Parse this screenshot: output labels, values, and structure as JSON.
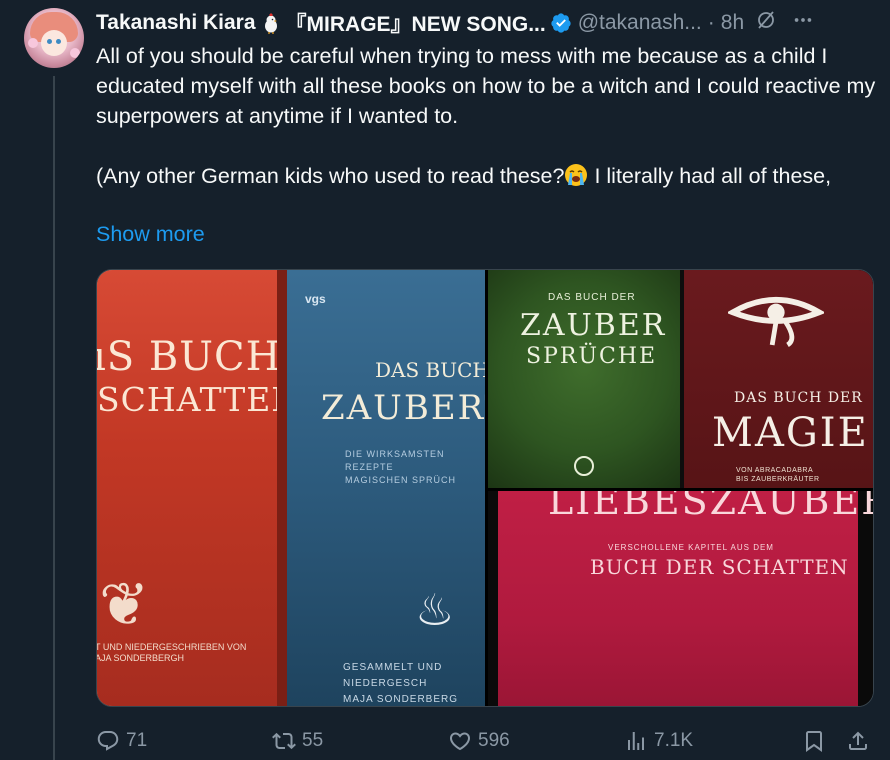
{
  "author": {
    "display_name": "Takanashi Kiara",
    "title_suffix": "『MIRAGE』NEW SONG...",
    "handle": "@takanash...",
    "time": "8h"
  },
  "tweet": {
    "paragraph1": "All of you should be careful when trying to mess with me because as a child I educated myself with all these books on how to be a witch and I could reactive my superpowers at anytime if I wanted to.",
    "paragraph2_a": "(Any other German kids who used to read these?",
    "paragraph2_b": " I literally had all of these,",
    "show_more": "Show more"
  },
  "media": {
    "book1": {
      "line1": "ıS BUCH",
      "line2": "SCHATTEN",
      "credit": "T UND NIEDERGESCHRIEBEN VON\nAJA SONDERBERGH"
    },
    "book2": {
      "publisher": "vgs",
      "line1": "DAS BUCH DER",
      "line2": "ZAUBERTRÄ",
      "subtitle": "DIE WIRKSAMSTEN REZEPTE\nMAGISCHEN SPRÜCH",
      "credit": "GESAMMELT UND NIEDERGESCH\nMAJA SONDERBERG"
    },
    "book3": {
      "small": "DAS BUCH DER",
      "line1": "ZAUBER",
      "line2": "SPRÜCHE"
    },
    "book4": {
      "small": "DAS BUCH DER",
      "title": "MAGIE",
      "subtitle": "VON ABRACADABRA\nBIS ZAUBERKRÄUTER"
    },
    "book5": {
      "title": "LIEBESZAUBER",
      "subtitle": "VERSCHOLLENE KAPITEL AUS DEM",
      "line2": "BUCH DER SCHATTEN"
    }
  },
  "actions": {
    "replies": "71",
    "reposts": "55",
    "likes": "596",
    "views": "7.1K"
  },
  "colors": {
    "background": "#15202b",
    "text": "#f7f9f9",
    "muted": "#8b98a5",
    "link": "#1d9bf0",
    "verified": "#1d9bf0"
  }
}
